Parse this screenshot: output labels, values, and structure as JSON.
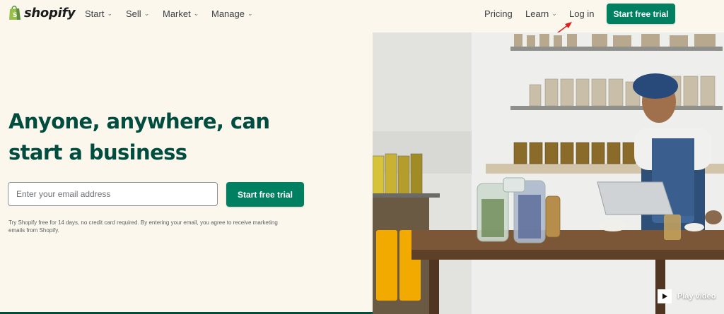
{
  "brand": {
    "name": "shopify"
  },
  "nav": {
    "left_items": [
      {
        "label": "Start"
      },
      {
        "label": "Sell"
      },
      {
        "label": "Market"
      },
      {
        "label": "Manage"
      }
    ],
    "pricing": "Pricing",
    "learn": "Learn",
    "login": "Log in",
    "cta": "Start free trial"
  },
  "hero": {
    "headline_line1": "Anyone, anywhere, can",
    "headline_line2": "start a business",
    "email_placeholder": "Enter your email address",
    "cta": "Start free trial",
    "disclaimer": "Try Shopify free for 14 days, no credit card required. By entering your email, you agree to receive marketing emails from Shopify."
  },
  "media": {
    "play_label": "Play video"
  },
  "icons": {
    "logo": "shopping-bag-icon",
    "dropdown": "chevron-down-icon",
    "annotation": "red-arrow-icon",
    "play": "play-icon"
  },
  "colors": {
    "brand_green": "#008060",
    "headline_green": "#004c3f",
    "background": "#fbf7ed",
    "annotation_red": "#e0201b"
  }
}
